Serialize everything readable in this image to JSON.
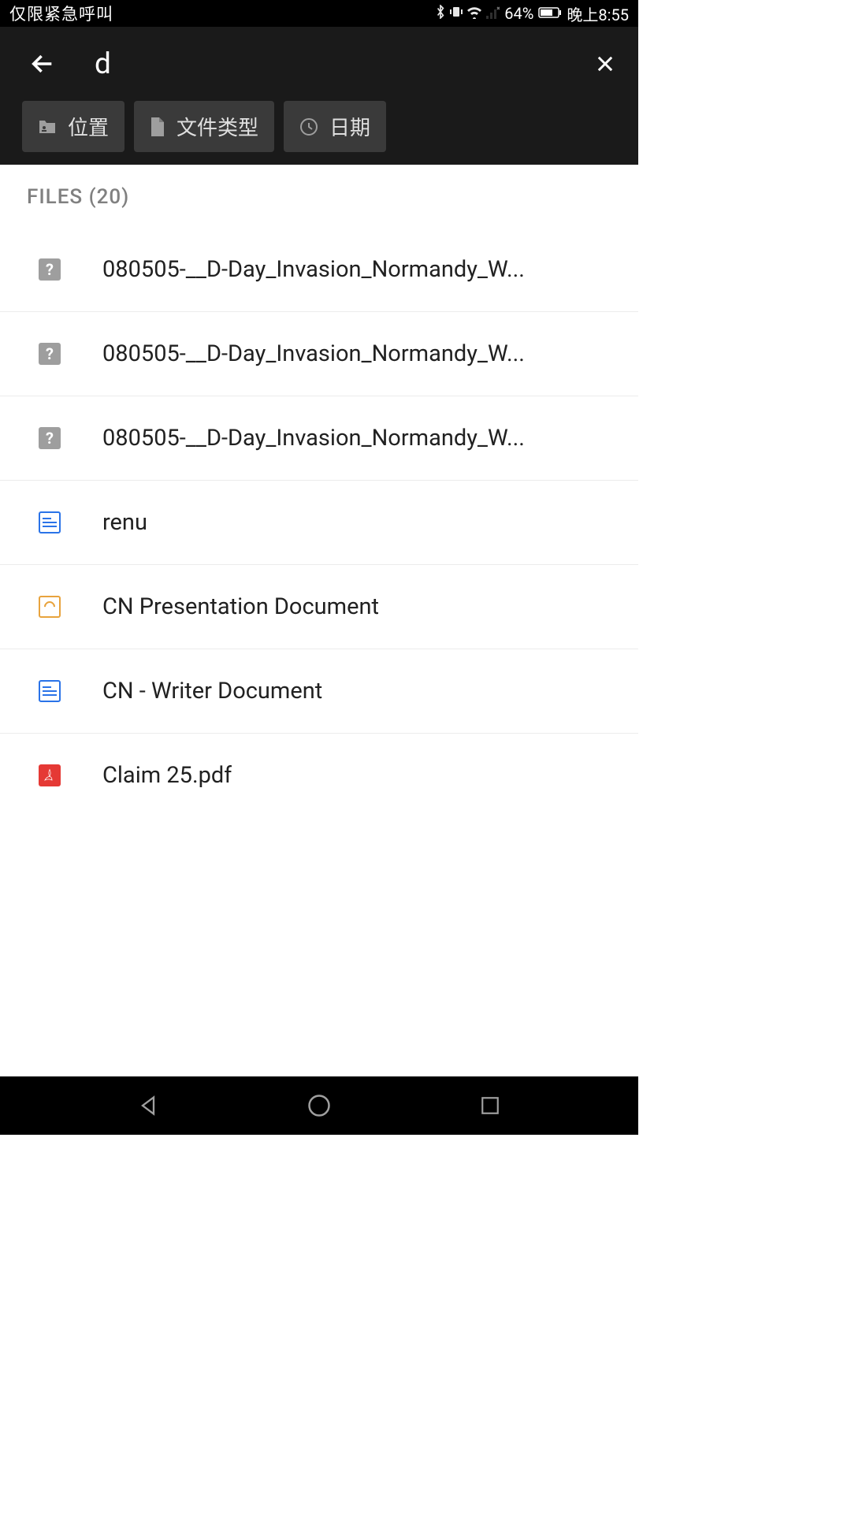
{
  "status": {
    "left": "仅限紧急呼叫",
    "battery": "64%",
    "time": "晚上8:55"
  },
  "search": {
    "query": "d"
  },
  "filters": {
    "location": "位置",
    "filetype": "文件类型",
    "date": "日期"
  },
  "section": {
    "header": "FILES (20)"
  },
  "files": [
    {
      "name": "080505-__D-Day_Invasion_Normandy_W...",
      "type": "unknown"
    },
    {
      "name": "080505-__D-Day_Invasion_Normandy_W...",
      "type": "unknown"
    },
    {
      "name": "080505-__D-Day_Invasion_Normandy_W...",
      "type": "unknown"
    },
    {
      "name": "renu",
      "type": "doc"
    },
    {
      "name": "CN Presentation Document",
      "type": "pres"
    },
    {
      "name": "CN - Writer Document",
      "type": "doc"
    },
    {
      "name": "Claim  25.pdf",
      "type": "pdf"
    }
  ]
}
